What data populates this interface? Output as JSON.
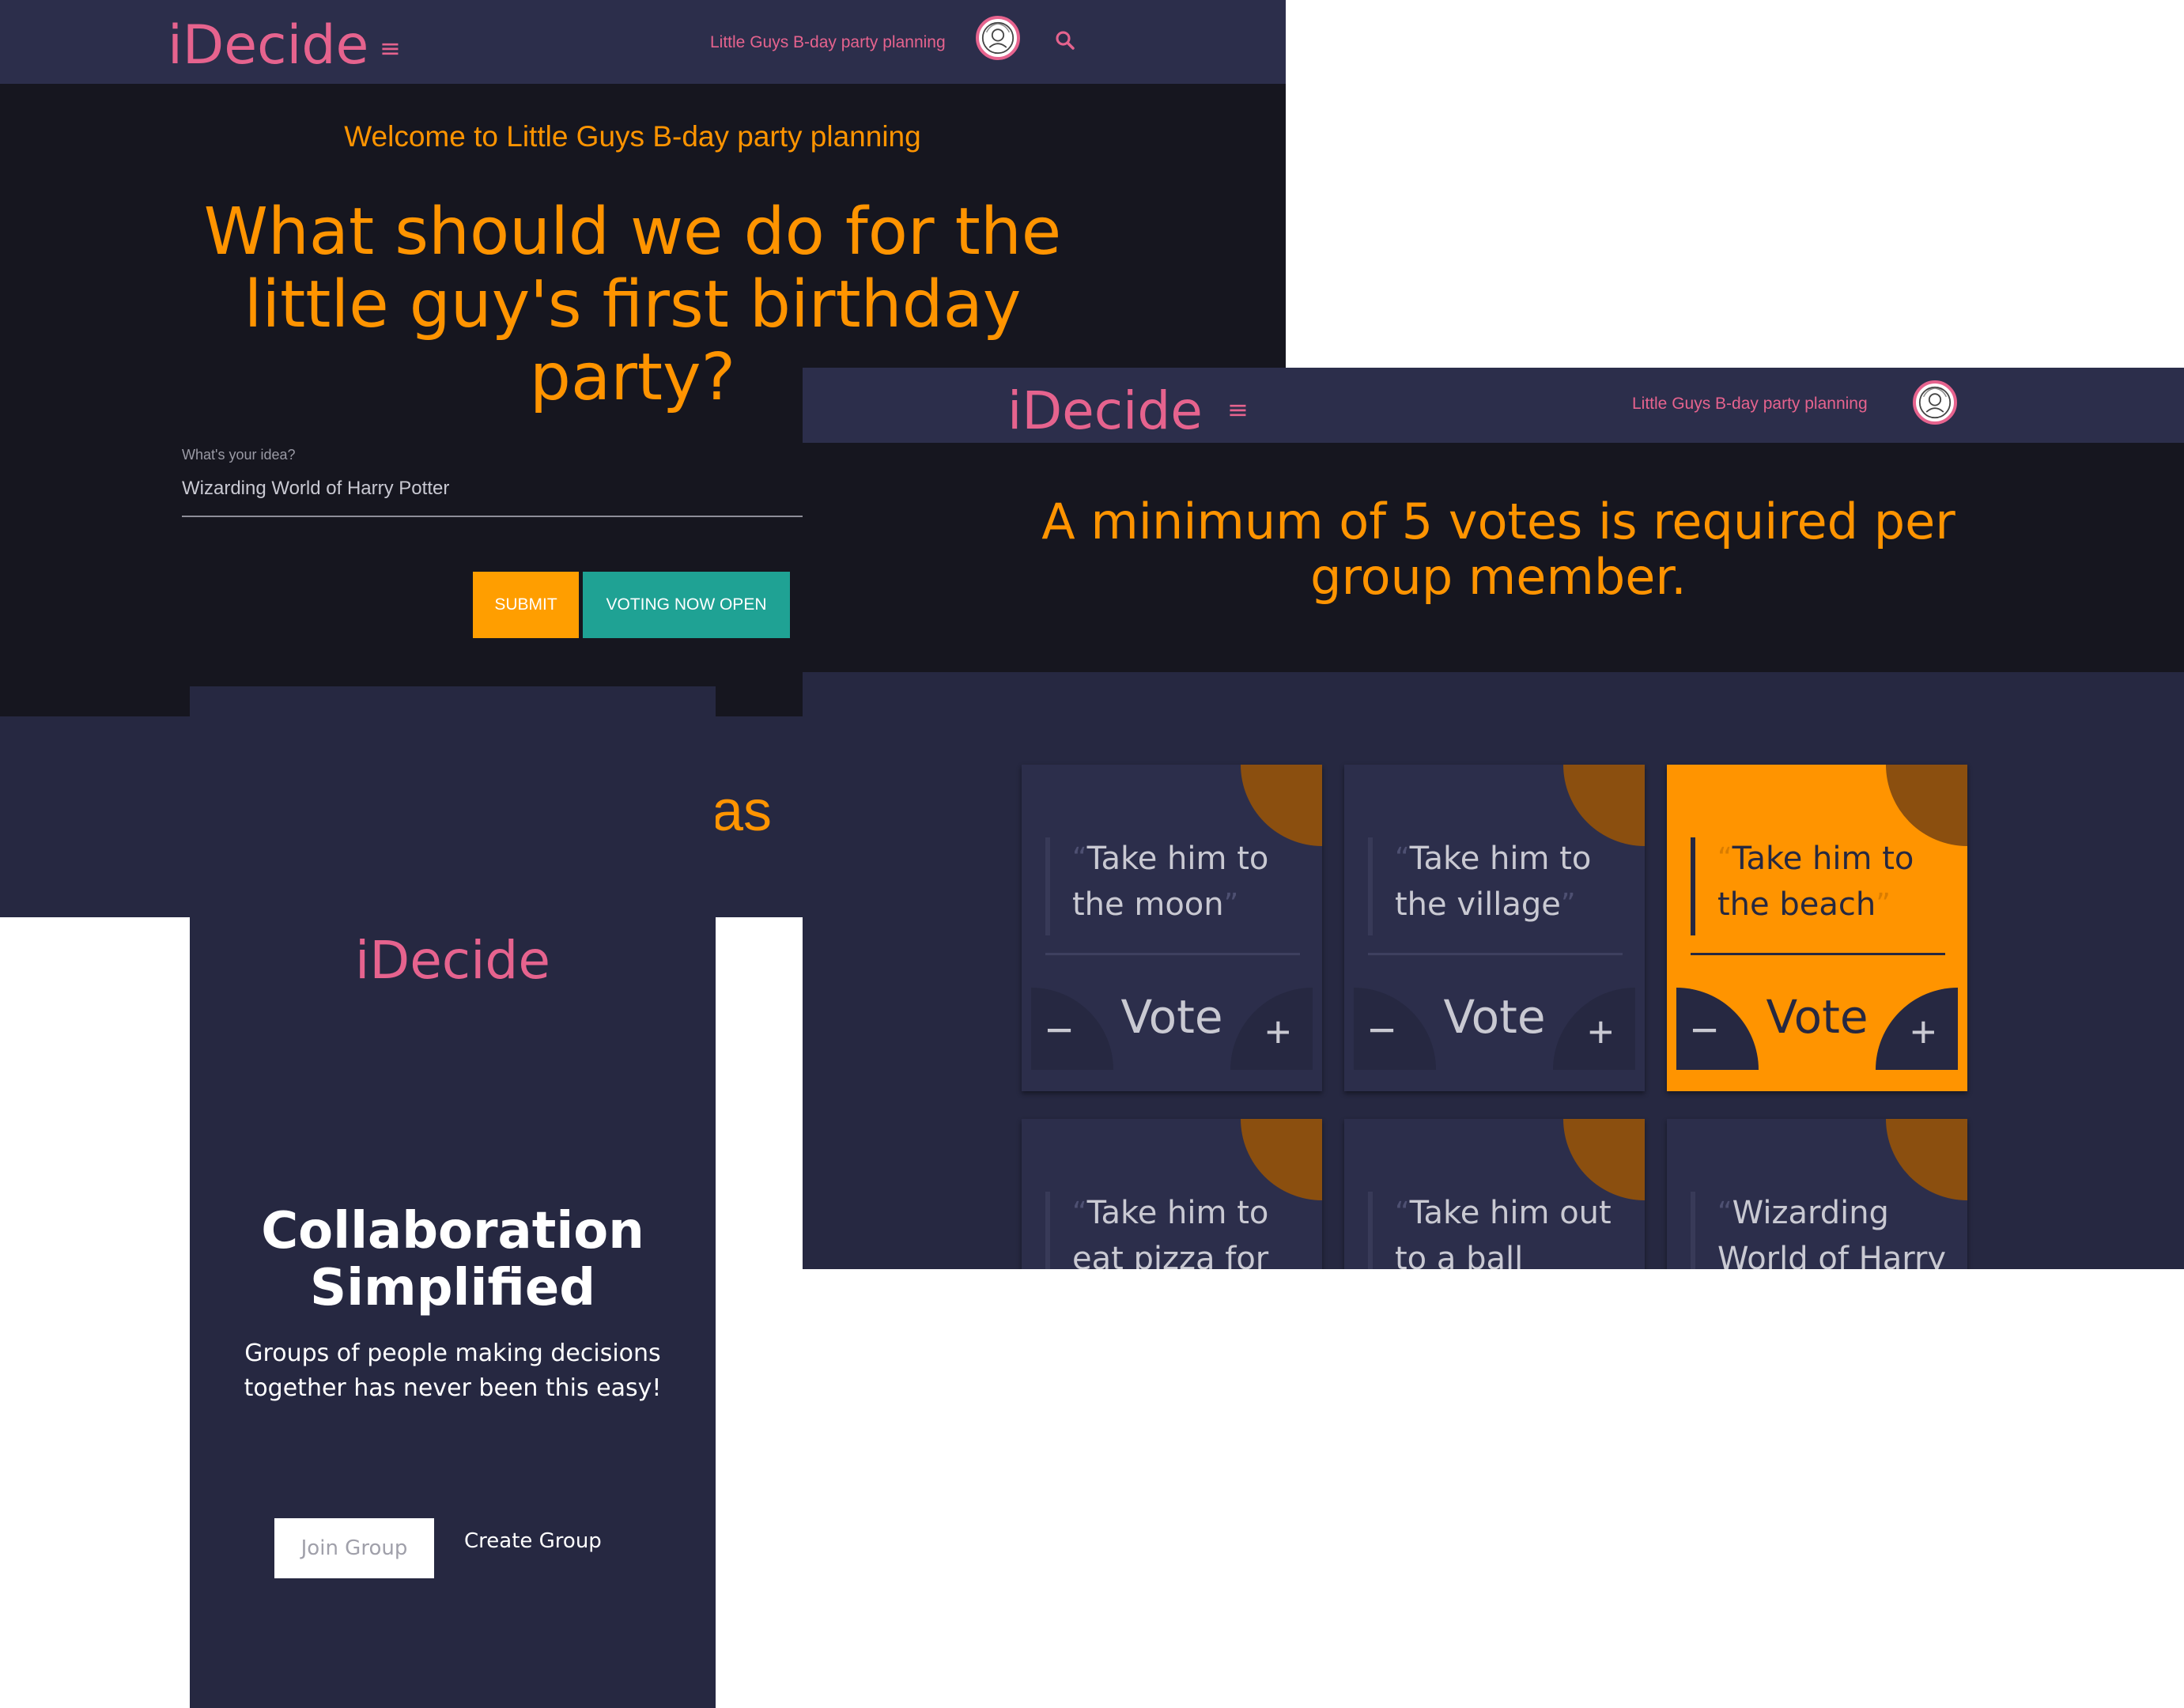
{
  "screen1": {
    "brand": "iDecide",
    "menu_icon": "hamburger-icon",
    "party_link": "Little Guys B-day party planning",
    "search_icon": "search-icon",
    "welcome": "Welcome to Little Guys B-day party planning",
    "question": "What should we do for the little guy's first birthday party?",
    "idea_label": "What's your idea?",
    "idea_value": "Wizarding World of Harry Potter",
    "submit_label": "SUBMIT",
    "voting_label": "VOTING NOW OPEN",
    "fragment": "as"
  },
  "screen2": {
    "brand": "iDecide",
    "party_link": "Little Guys B-day party planning",
    "min_votes": "A minimum of 5 votes is required per group member.",
    "vote_label": "Vote",
    "minus_label": "−",
    "plus_label": "+",
    "cards": [
      {
        "text": "Take him to the moon",
        "active": false
      },
      {
        "text": "Take him to the village",
        "active": false
      },
      {
        "text": "Take him to the beach",
        "active": true
      },
      {
        "text": "Take him to eat pizza for the",
        "active": false
      },
      {
        "text": "Take him out to a ball game",
        "active": false
      },
      {
        "text": "Wizarding World of Harry",
        "active": false
      }
    ]
  },
  "screen3": {
    "brand": "iDecide",
    "title": "Collaboration Simplified",
    "description": "Groups of people making decisions together has never been this easy!",
    "join_label": "Join Group",
    "create_label": "Create Group"
  },
  "colors": {
    "accent_orange": "#ff9400",
    "brand_pink": "#e6638e",
    "teal": "#1fa294",
    "navy": "#262841",
    "dark": "#16161f"
  }
}
